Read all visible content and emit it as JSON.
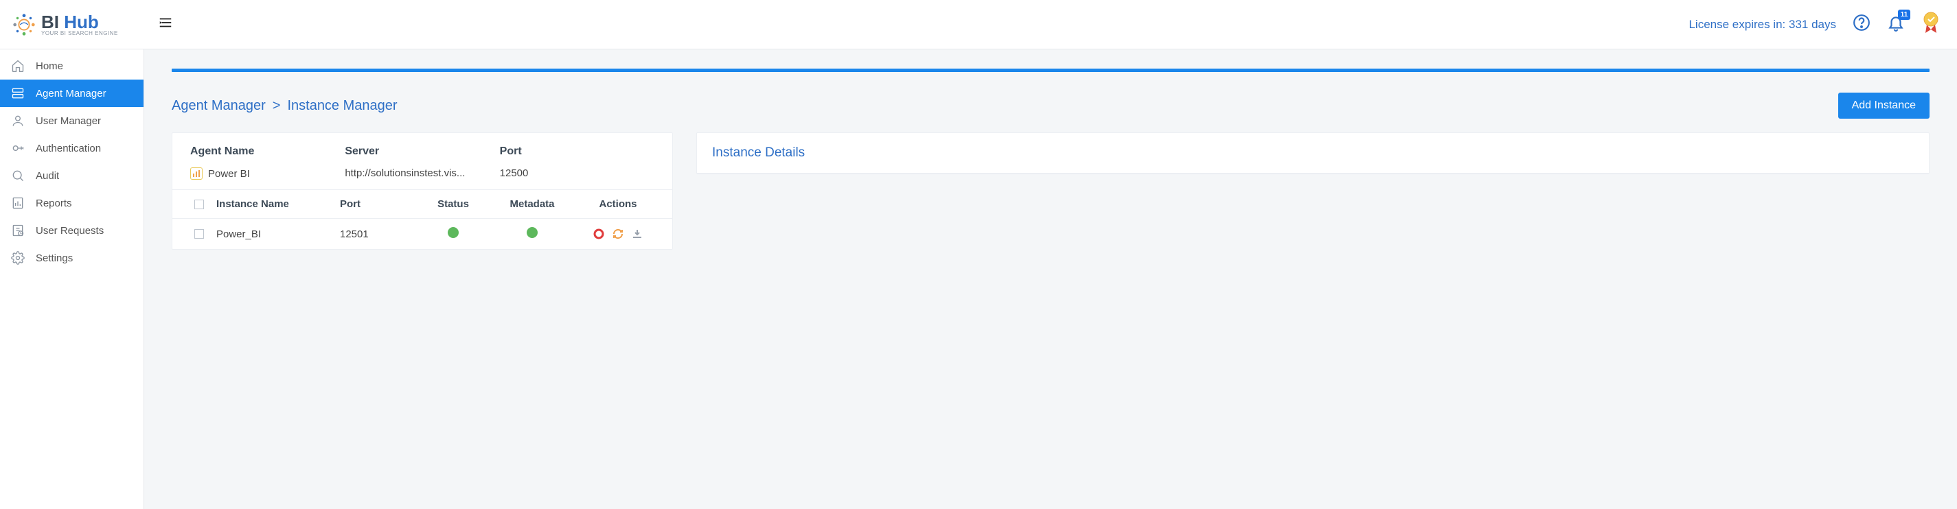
{
  "header": {
    "logo_bi": "BI",
    "logo_hub": "Hub",
    "logo_tag": "YOUR BI SEARCH ENGINE",
    "license_text": "License expires in: 331 days",
    "notification_count": "11"
  },
  "sidebar": {
    "items": [
      {
        "label": "Home"
      },
      {
        "label": "Agent Manager"
      },
      {
        "label": "User Manager"
      },
      {
        "label": "Authentication"
      },
      {
        "label": "Audit"
      },
      {
        "label": "Reports"
      },
      {
        "label": "User Requests"
      },
      {
        "label": "Settings"
      }
    ]
  },
  "breadcrumb": {
    "root": "Agent Manager",
    "sep": ">",
    "current": "Instance Manager"
  },
  "buttons": {
    "add_instance": "Add Instance"
  },
  "agent_info": {
    "name_label": "Agent Name",
    "name_value": "Power BI",
    "server_label": "Server",
    "server_value": "http://solutionsinstest.vis...",
    "port_label": "Port",
    "port_value": "12500"
  },
  "table": {
    "headers": {
      "instance_name": "Instance Name",
      "port": "Port",
      "status": "Status",
      "metadata": "Metadata",
      "actions": "Actions"
    },
    "rows": [
      {
        "name": "Power_BI",
        "port": "12501"
      }
    ]
  },
  "details": {
    "title": "Instance Details"
  }
}
